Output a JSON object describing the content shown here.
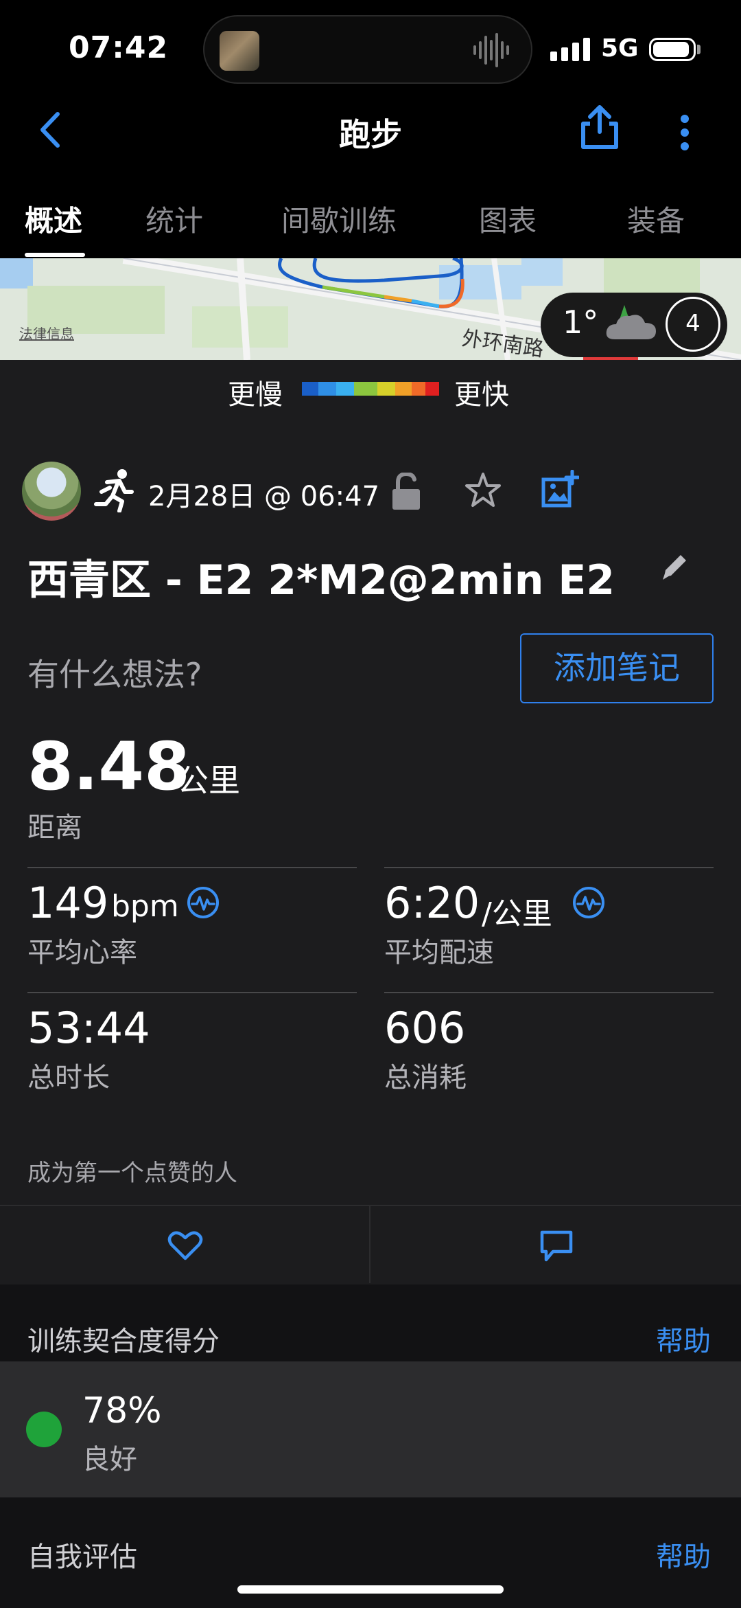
{
  "status_bar": {
    "time": "07:42",
    "network": "5G"
  },
  "header": {
    "title": "跑步"
  },
  "tabs": [
    {
      "label": "概述",
      "active": true
    },
    {
      "label": "统计"
    },
    {
      "label": "间歇训练"
    },
    {
      "label": "图表"
    },
    {
      "label": "装备"
    }
  ],
  "map": {
    "legal_label": "法律信息",
    "road_label": "外环南路",
    "temperature": "1°",
    "wind_level": "4"
  },
  "speed_legend": {
    "slower": "更慢",
    "faster": "更快"
  },
  "activity": {
    "date": "2月28日 @ 06:47",
    "title": "西青区 - E2 2*M2@2min E2",
    "thoughts_prompt": "有什么想法?",
    "add_note_label": "添加笔记"
  },
  "metrics": {
    "distance": {
      "value": "8.48",
      "unit": "公里",
      "label": "距离"
    },
    "avg_hr": {
      "value": "149",
      "unit": "bpm",
      "label": "平均心率"
    },
    "avg_pace": {
      "value": "6:20",
      "unit": "/公里",
      "label": "平均配速"
    },
    "total_time": {
      "value": "53:44",
      "label": "总时长"
    },
    "calories": {
      "value": "606",
      "label": "总消耗"
    }
  },
  "social": {
    "first_like": "成为第一个点赞的人"
  },
  "training_fit": {
    "title": "训练契合度得分",
    "help": "帮助",
    "score": "78%",
    "rating": "良好",
    "color": "#1fa33a"
  },
  "self_eval": {
    "title": "自我评估",
    "help": "帮助"
  },
  "colors": {
    "accent": "#3a8ff2",
    "background": "#1c1c1e"
  }
}
